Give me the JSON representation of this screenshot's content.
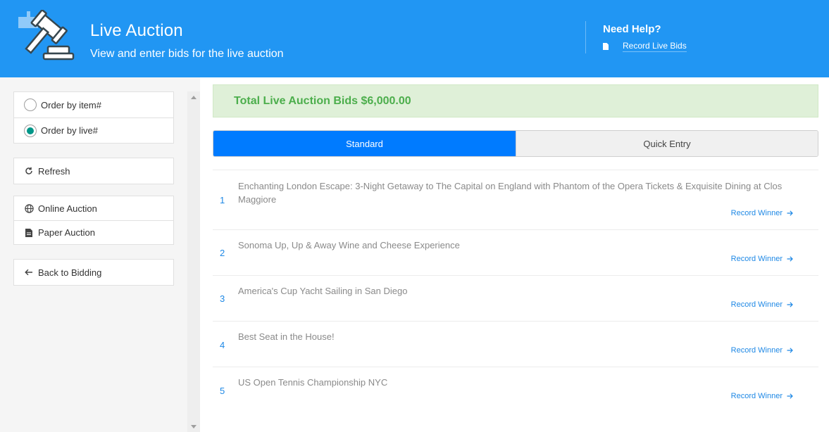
{
  "header": {
    "title": "Live Auction",
    "subtitle": "View and enter bids for the live auction",
    "help_title": "Need Help?",
    "help_link": "Record Live Bids",
    "logo_icon": "gavel-icon",
    "help_icon": "document-icon",
    "bg_color": "#2196f3"
  },
  "sidebar": {
    "order_options": [
      {
        "label": "Order by item#",
        "checked": false
      },
      {
        "label": "Order by live#",
        "checked": true
      }
    ],
    "refresh_label": "Refresh",
    "auction_links": [
      {
        "label": "Online Auction",
        "icon": "globe-icon"
      },
      {
        "label": "Paper Auction",
        "icon": "document-icon"
      }
    ],
    "back_label": "Back to Bidding"
  },
  "main": {
    "total_label": "Total Live Auction Bids $6,000.00",
    "tabs": [
      {
        "label": "Standard",
        "active": true
      },
      {
        "label": "Quick Entry",
        "active": false
      }
    ],
    "record_winner_label": "Record Winner",
    "items": [
      {
        "number": "1",
        "name": "Enchanting London Escape: 3-Night Getaway to The Capital on England with Phantom of the Opera Tickets & Exquisite Dining at Clos Maggiore"
      },
      {
        "number": "2",
        "name": "Sonoma Up, Up & Away Wine and Cheese Experience"
      },
      {
        "number": "3",
        "name": "America's Cup Yacht Sailing in San Diego"
      },
      {
        "number": "4",
        "name": "Best Seat in the House!"
      },
      {
        "number": "5",
        "name": "US Open Tennis Championship NYC"
      }
    ]
  },
  "colors": {
    "accent": "#007bff",
    "link": "#1e88e5",
    "success_text": "#4cae4c",
    "success_bg": "#dff0d8",
    "radio_checked": "#009688"
  }
}
